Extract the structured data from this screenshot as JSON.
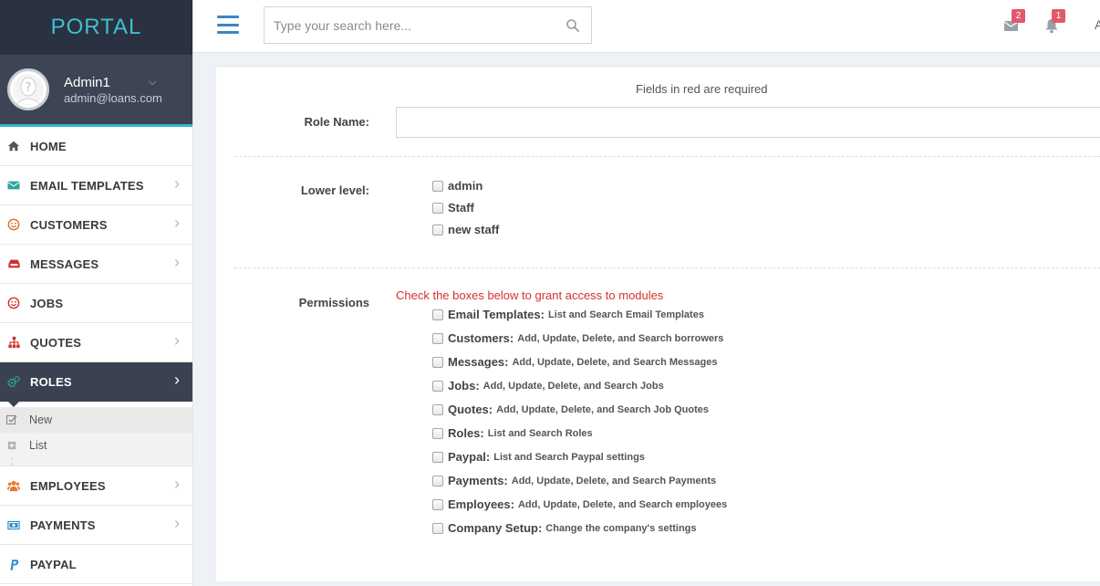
{
  "brand": {
    "title": "PORTAL"
  },
  "user": {
    "name": "Admin1",
    "email": "admin@loans.com"
  },
  "sidebar": {
    "items": [
      {
        "label": "HOME",
        "icon": "home-icon",
        "color": "#555555",
        "arrow": false
      },
      {
        "label": "EMAIL TEMPLATES",
        "icon": "envelope-icon",
        "color": "#2fa69a",
        "arrow": true
      },
      {
        "label": "CUSTOMERS",
        "icon": "smile-icon",
        "color": "#e06a2b",
        "arrow": true
      },
      {
        "label": "MESSAGES",
        "icon": "inbox-icon",
        "color": "#d0312d",
        "arrow": true
      },
      {
        "label": "JOBS",
        "icon": "smile-icon",
        "color": "#d0312d",
        "arrow": false
      },
      {
        "label": "QUOTES",
        "icon": "sitemap-icon",
        "color": "#d0312d",
        "arrow": true
      },
      {
        "label": "ROLES",
        "icon": "cogs-icon",
        "color": "#2fa69a",
        "arrow": true,
        "active": true
      }
    ],
    "submenu": [
      {
        "label": "New",
        "icon": "check-square-icon"
      },
      {
        "label": "List",
        "icon": "plus-square-icon"
      }
    ],
    "items_after": [
      {
        "label": "EMPLOYEES",
        "icon": "users-icon",
        "color": "#e8792b",
        "arrow": true
      },
      {
        "label": "PAYMENTS",
        "icon": "money-icon",
        "color": "#2a8ac8",
        "arrow": true
      },
      {
        "label": "PAYPAL",
        "icon": "paypal-icon",
        "color": "#2a8ac8",
        "arrow": false
      }
    ]
  },
  "topbar": {
    "search_placeholder": "Type your search here...",
    "mail_count": "2",
    "notification_count": "1",
    "user_initial": "A"
  },
  "form": {
    "required_note": "Fields in red are required",
    "role_name_label": "Role Name:",
    "role_name_value": "",
    "lower_level_label": "Lower level:",
    "lower_levels": [
      "admin",
      "Staff",
      "new staff"
    ],
    "permissions_label": "Permissions",
    "permissions_hint": "Check the boxes below to grant access to modules",
    "permissions": [
      {
        "module": "Email Templates:",
        "desc": "List and Search Email Templates"
      },
      {
        "module": "Customers:",
        "desc": "Add, Update, Delete, and Search borrowers"
      },
      {
        "module": "Messages:",
        "desc": "Add, Update, Delete, and Search Messages"
      },
      {
        "module": "Jobs:",
        "desc": "Add, Update, Delete, and Search Jobs"
      },
      {
        "module": "Quotes:",
        "desc": "Add, Update, Delete, and Search Job Quotes"
      },
      {
        "module": "Roles:",
        "desc": "List and Search Roles"
      },
      {
        "module": "Paypal:",
        "desc": "List and Search Paypal settings"
      },
      {
        "module": "Payments:",
        "desc": "Add, Update, Delete, and Search Payments"
      },
      {
        "module": "Employees:",
        "desc": "Add, Update, Delete, and Search employees"
      },
      {
        "module": "Company Setup:",
        "desc": "Change the company's settings"
      }
    ]
  }
}
